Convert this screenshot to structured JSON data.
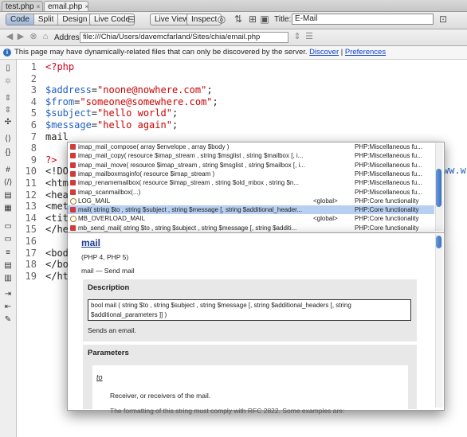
{
  "tabs": [
    {
      "label": "test.php",
      "close": "×"
    },
    {
      "label": "email.php",
      "close": "×"
    }
  ],
  "toolbar": {
    "views": [
      "Code",
      "Split",
      "Design"
    ],
    "live_code": "Live Code",
    "live_view": "Live View",
    "inspect": "Inspect",
    "title_label": "Title:",
    "title_value": "E-Mail"
  },
  "address": {
    "label": "Address:",
    "value": "file:///Chia/Users/davemcfarland/Sites/chia/email.php"
  },
  "info": {
    "text": "This page may have dynamically-related files that can only be discovered by the server.",
    "discover": "Discover",
    "sep": "|",
    "preferences": "Preferences"
  },
  "code": {
    "line_numbers": [
      "1",
      "2",
      "3",
      "4",
      "5",
      "6",
      "7",
      "8",
      "9",
      "10",
      "11",
      "12",
      "13",
      "14",
      "15",
      "16",
      "17",
      "18",
      "19"
    ],
    "lines": [
      {
        "kind": "php",
        "text": "<?php"
      },
      {
        "kind": "blank",
        "text": ""
      },
      {
        "kind": "assign",
        "var": "$address",
        "eq": "=",
        "str": "\"noone@nowhere.com\"",
        "end": ";"
      },
      {
        "kind": "assign",
        "var": "$from",
        "eq": "=",
        "str": "\"someone@somewhere.com\"",
        "end": ";"
      },
      {
        "kind": "assign",
        "var": "$subject",
        "eq": "=",
        "str": "\"hello world\"",
        "end": ";"
      },
      {
        "kind": "assign",
        "var": "$message",
        "eq": "=",
        "str": "\"hello again\"",
        "end": ";"
      },
      {
        "kind": "plain",
        "text": "mail"
      },
      {
        "kind": "blank",
        "text": ""
      },
      {
        "kind": "php",
        "text": "?>"
      },
      {
        "kind": "tag",
        "text": "<!DO"
      },
      {
        "kind": "tag",
        "text": "<htm"
      },
      {
        "kind": "tag",
        "text": "<hea"
      },
      {
        "kind": "tag",
        "text": "<met"
      },
      {
        "kind": "tag",
        "text": "<tit"
      },
      {
        "kind": "tag",
        "text": "</he"
      },
      {
        "kind": "blank",
        "text": ""
      },
      {
        "kind": "tag",
        "text": "<bod"
      },
      {
        "kind": "tag",
        "text": "</bo"
      },
      {
        "kind": "tag",
        "text": "</ht"
      }
    ],
    "overflow_fragment": "ww.w"
  },
  "hints": [
    {
      "icon": "function",
      "text": "imap_mail_compose( array $envelope , array $body )",
      "scope": "",
      "category": "PHP:Miscellaneous fu..."
    },
    {
      "icon": "function",
      "text": "imap_mail_copy( resource $imap_stream , string $msglist , string $mailbox [, i...",
      "scope": "",
      "category": "PHP:Miscellaneous fu..."
    },
    {
      "icon": "function",
      "text": "imap_mail_move( resource $imap_stream , string $msglist , string $mailbox [, i...",
      "scope": "",
      "category": "PHP:Miscellaneous fu..."
    },
    {
      "icon": "function",
      "text": "imap_mailboxmsginfo( resource $imap_stream )",
      "scope": "",
      "category": "PHP:Miscellaneous fu..."
    },
    {
      "icon": "function",
      "text": "imap_renamemailbox( resource $imap_stream , string $old_mbox , string $n...",
      "scope": "",
      "category": "PHP:Miscellaneous fu..."
    },
    {
      "icon": "function",
      "text": "imap_scanmailbox(...)",
      "scope": "",
      "category": "PHP:Miscellaneous fu..."
    },
    {
      "icon": "constant",
      "text": "LOG_MAIL",
      "scope": "<global>",
      "category": "PHP:Core functionality"
    },
    {
      "icon": "function",
      "text": "mail( string $to , string $subject , string $message [, string $additional_header...",
      "scope": "",
      "category": "PHP:Core functionality",
      "selected": true
    },
    {
      "icon": "constant",
      "text": "MB_OVERLOAD_MAIL",
      "scope": "<global>",
      "category": "PHP:Core functionality"
    },
    {
      "icon": "function",
      "text": "mb_send_mail( string $to , string $subject , string $message [, string $additi...",
      "scope": "",
      "category": "PHP:Core functionality"
    }
  ],
  "doc": {
    "title": "mail",
    "version": "(PHP 4, PHP 5)",
    "short": "mail — Send mail",
    "description_heading": "Description",
    "syntax_line1": "bool mail ( string $to , string $subject , string $message [, string $additional_headers [, string",
    "syntax_line2": "$additional_parameters ]] )",
    "sends": "Sends an email.",
    "parameters_heading": "Parameters",
    "param_name": "to",
    "param_desc": "Receiver, or receivers of the mail.",
    "param_more": "The formatting of this string must comply with RFC 2822. Some examples are:"
  }
}
